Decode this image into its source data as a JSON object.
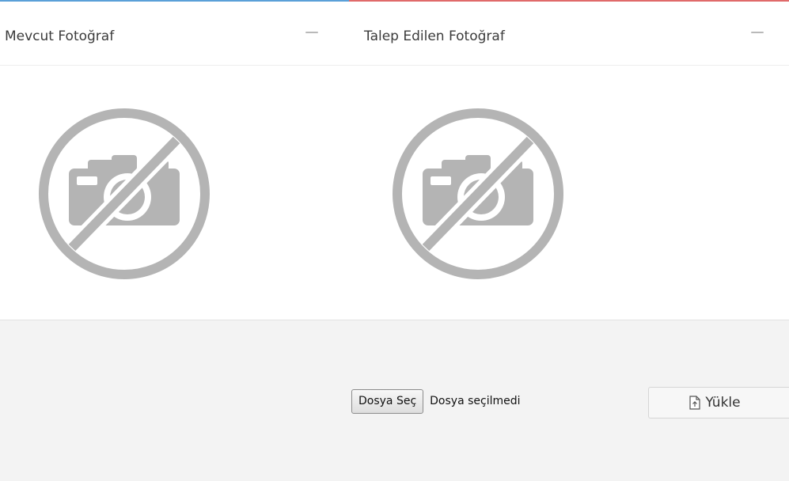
{
  "current_photo_panel": {
    "title": "Mevcut Fotoğraf",
    "accent_color": "#5aa0d8",
    "icon": "no-photo-icon"
  },
  "requested_photo_panel": {
    "title": "Talep Edilen Fotoğraf",
    "accent_color": "#e06a6a",
    "icon": "no-photo-icon"
  },
  "file_input": {
    "button_label": "Dosya Seç",
    "status_text": "Dosya seçilmedi"
  },
  "upload": {
    "label": "Yükle",
    "icon": "file-upload-icon"
  },
  "colors": {
    "placeholder_gray": "#b4b4b4",
    "panel_background": "#ffffff",
    "page_background": "#f3f3f3"
  }
}
